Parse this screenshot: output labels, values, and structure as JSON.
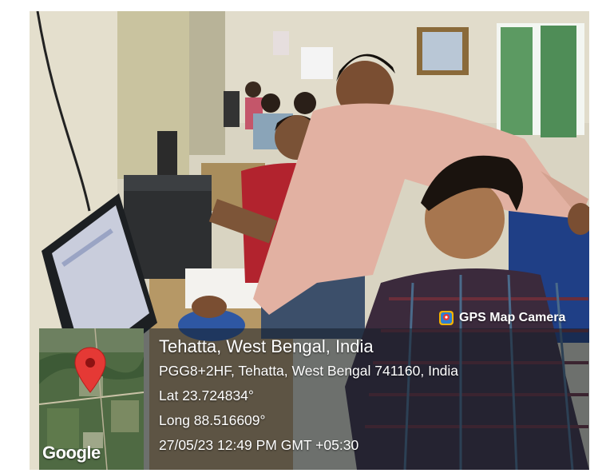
{
  "badge": {
    "label": "GPS Map Camera",
    "icon": "gps-camera-icon"
  },
  "map": {
    "watermark": "Google",
    "icon": "map-pin-icon",
    "pin_color": "#e53935"
  },
  "location": {
    "place": "Tehatta, West Bengal, India",
    "address": "PGG8+2HF, Tehatta, West Bengal 741160, India",
    "lat": "Lat 23.724834°",
    "long": "Long 88.516609°",
    "datetime": "27/05/23 12:49 PM GMT +05:30"
  }
}
